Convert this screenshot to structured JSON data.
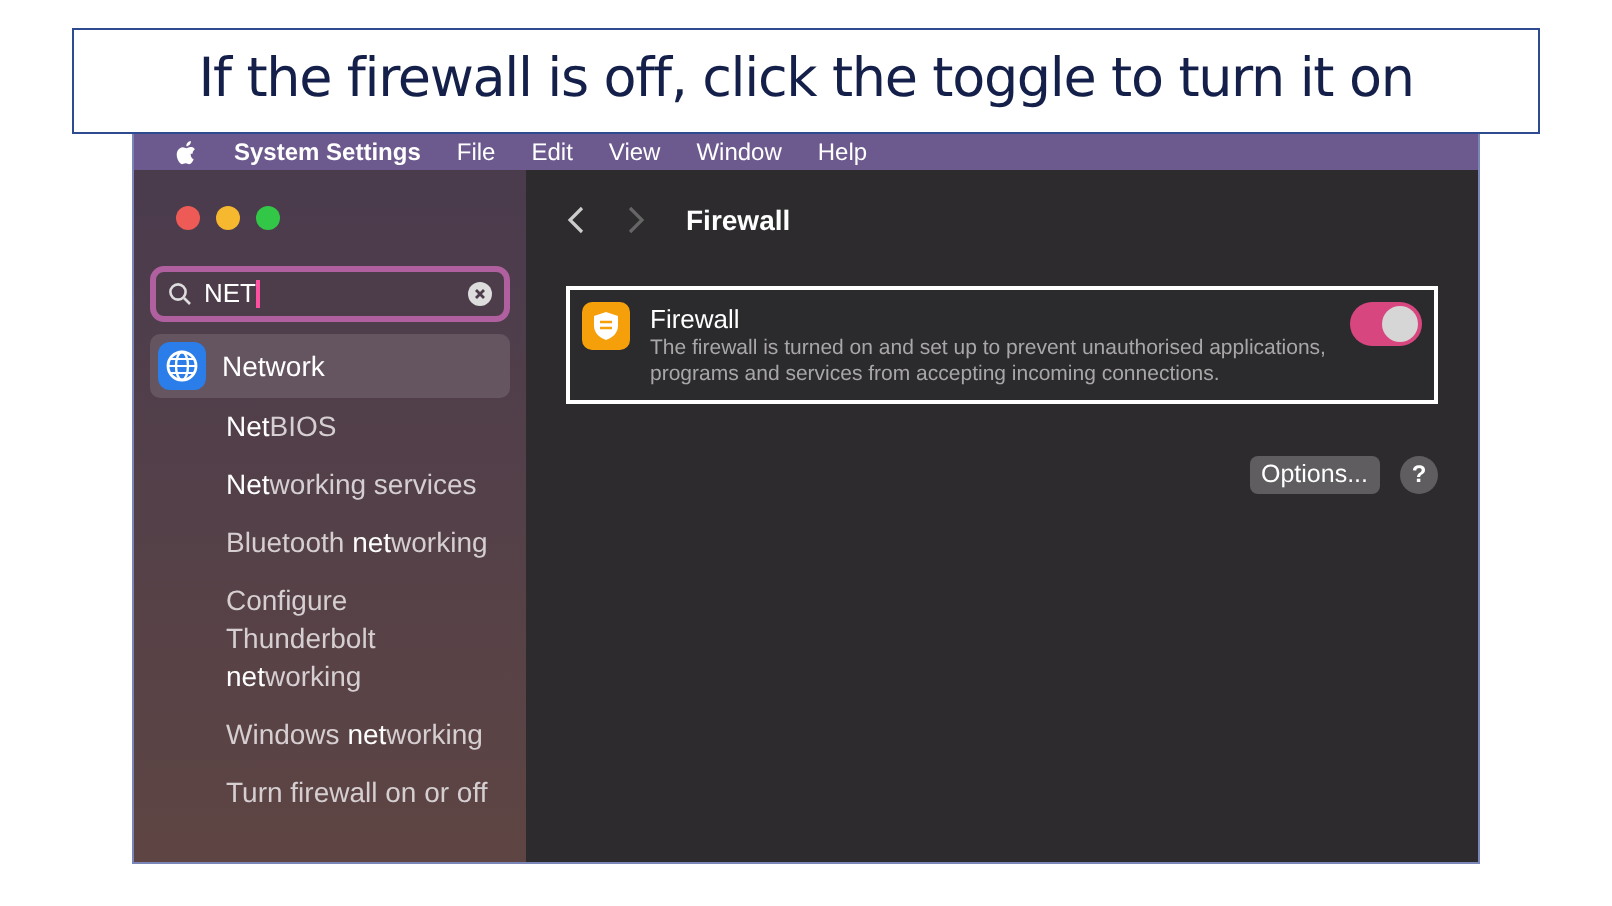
{
  "callout": "If the firewall is off, click the toggle to turn it on",
  "menu_bar": {
    "app": "System Settings",
    "items": [
      "File",
      "Edit",
      "View",
      "Window",
      "Help"
    ]
  },
  "sidebar": {
    "search": {
      "value": "NET"
    },
    "items": [
      {
        "label": "**Net**work",
        "selected": true,
        "kind": "icon"
      },
      {
        "label": "**Net**BIOS",
        "selected": false,
        "kind": "plain"
      },
      {
        "label": "**Net**working services",
        "selected": false,
        "kind": "plain"
      },
      {
        "label": "Bluetooth **net**working",
        "selected": false,
        "kind": "plain"
      },
      {
        "label": "Configure Thunderbolt **net**working",
        "selected": false,
        "kind": "plain"
      },
      {
        "label": "Windows **net**working",
        "selected": false,
        "kind": "plain"
      },
      {
        "label": "Turn firewall on or off",
        "selected": false,
        "kind": "plain"
      }
    ]
  },
  "content": {
    "title": "Firewall",
    "setting": {
      "title": "Firewall",
      "description": "The firewall is turned on and set up to prevent unauthorised applications, programs and services from accepting incoming connections.",
      "on": true
    },
    "options_button": "Options...",
    "help_button": "?"
  }
}
